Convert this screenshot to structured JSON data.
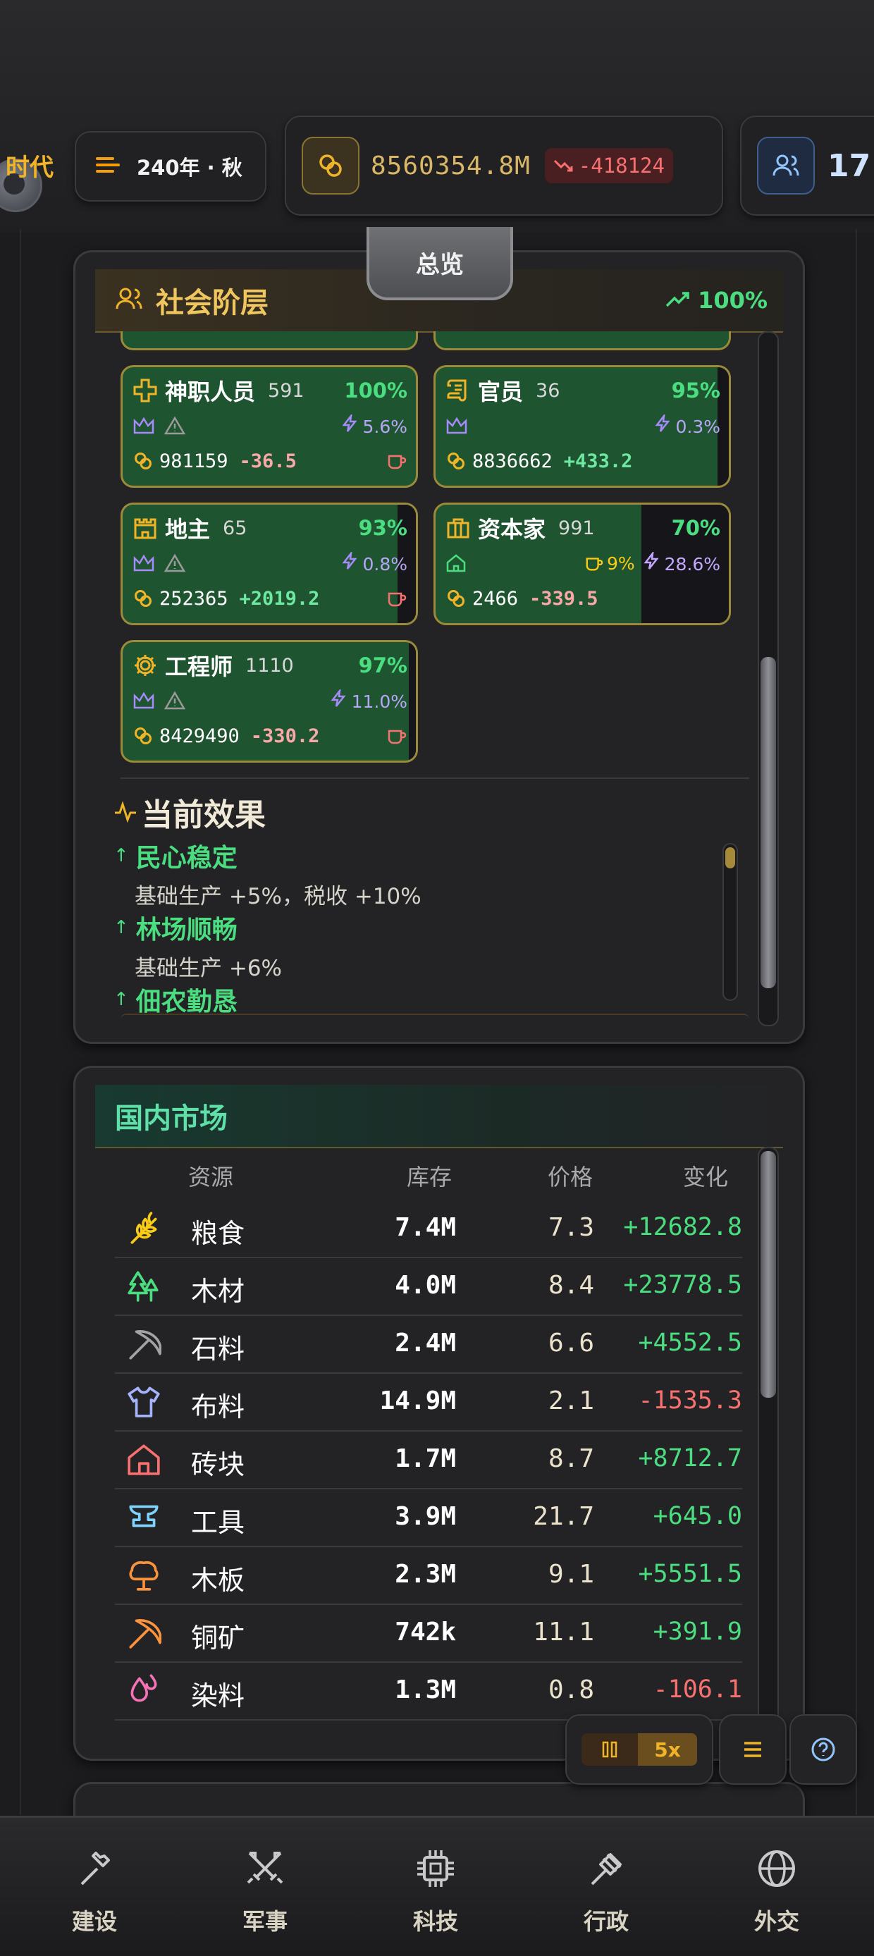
{
  "topbar": {
    "era": "时代",
    "date": "240年 · 秋",
    "treasury": "8560354.8M",
    "treasury_change": "-418124",
    "population": "17"
  },
  "overview_tab": "总览",
  "social": {
    "title": "社会阶层",
    "stability": "100%",
    "classes": [
      {
        "name": "神职人员",
        "count": "591",
        "pct": "100%",
        "power": "5.6%",
        "wealth": "981159",
        "delta": "-36.5"
      },
      {
        "name": "官员",
        "count": "36",
        "pct": "95%",
        "power": "0.3%",
        "wealth": "8836662",
        "delta": "+433.2"
      },
      {
        "name": "地主",
        "count": "65",
        "pct": "93%",
        "power": "0.8%",
        "wealth": "252365",
        "delta": "+2019.2"
      },
      {
        "name": "资本家",
        "count": "991",
        "pct": "70%",
        "tax": "9%",
        "power": "28.6%",
        "wealth": "2466",
        "delta": "-339.5"
      },
      {
        "name": "工程师",
        "count": "1110",
        "pct": "97%",
        "power": "11.0%",
        "wealth": "8429490",
        "delta": "-330.2"
      }
    ],
    "effects_title": "当前效果",
    "effects": [
      {
        "name": "民心稳定",
        "desc": "基础生产 +5%，税收 +10%"
      },
      {
        "name": "林场顺畅",
        "desc": "基础生产 +6%"
      },
      {
        "name": "佃农勤恳"
      }
    ]
  },
  "market": {
    "title": "国内市场",
    "headers": {
      "resource": "资源",
      "stock": "库存",
      "price": "价格",
      "change": "变化"
    },
    "rows": [
      {
        "name": "粮食",
        "stock": "7.4M",
        "price": "7.3",
        "change": "+12682.8"
      },
      {
        "name": "木材",
        "stock": "4.0M",
        "price": "8.4",
        "change": "+23778.5"
      },
      {
        "name": "石料",
        "stock": "2.4M",
        "price": "6.6",
        "change": "+4552.5"
      },
      {
        "name": "布料",
        "stock": "14.9M",
        "price": "2.1",
        "change": "-1535.3"
      },
      {
        "name": "砖块",
        "stock": "1.7M",
        "price": "8.7",
        "change": "+8712.7"
      },
      {
        "name": "工具",
        "stock": "3.9M",
        "price": "21.7",
        "change": "+645.0"
      },
      {
        "name": "木板",
        "stock": "2.3M",
        "price": "9.1",
        "change": "+5551.5"
      },
      {
        "name": "铜矿",
        "stock": "742k",
        "price": "11.1",
        "change": "+391.9"
      },
      {
        "name": "染料",
        "stock": "1.3M",
        "price": "0.8",
        "change": "-106.1"
      }
    ]
  },
  "controls": {
    "speed": "5x"
  },
  "nav": [
    "建设",
    "军事",
    "科技",
    "行政",
    "外交"
  ],
  "colors": {
    "accent_gold": "#f0b429",
    "positive": "#4ade80",
    "negative": "#f87171",
    "card_green": "#1f5430"
  }
}
